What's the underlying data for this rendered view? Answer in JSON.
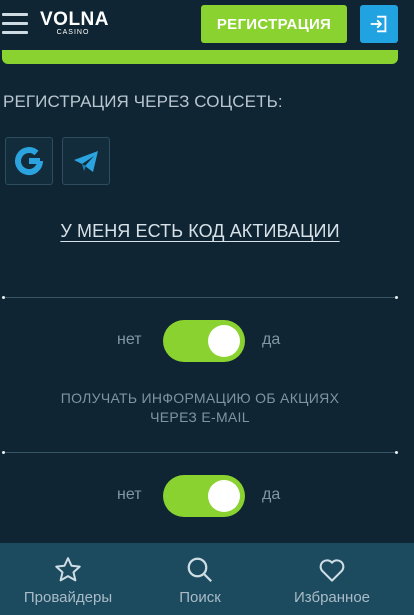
{
  "header": {
    "logo_brand": "VOLNA",
    "logo_sub": "CASINO",
    "register_label": "РЕГИСТРАЦИЯ"
  },
  "social": {
    "title": "РЕГИСТРАЦИЯ ЧЕРЕЗ СОЦСЕТЬ:",
    "buttons": [
      "google-icon",
      "telegram-icon"
    ]
  },
  "activation_link": "У МЕНЯ ЕСТЬ КОД АКТИВАЦИИ",
  "toggles": [
    {
      "no_label": "нет",
      "yes_label": "да",
      "state": "on"
    },
    {
      "no_label": "нет",
      "yes_label": "да",
      "state": "on"
    }
  ],
  "promo_text_line1": "ПОЛУЧАТЬ ИНФОРМАЦИЮ ОБ АКЦИЯХ",
  "promo_text_line2": "ЧЕРЕЗ E-MAIL",
  "bottom_nav": [
    {
      "label": "Провайдеры",
      "icon": "star-icon"
    },
    {
      "label": "Поиск",
      "icon": "search-icon"
    },
    {
      "label": "Избранное",
      "icon": "heart-icon"
    }
  ],
  "colors": {
    "background": "#0f2533",
    "accent_green": "#8ad230",
    "accent_blue": "#20a3e0",
    "nav_bg": "#1c4a5e"
  }
}
